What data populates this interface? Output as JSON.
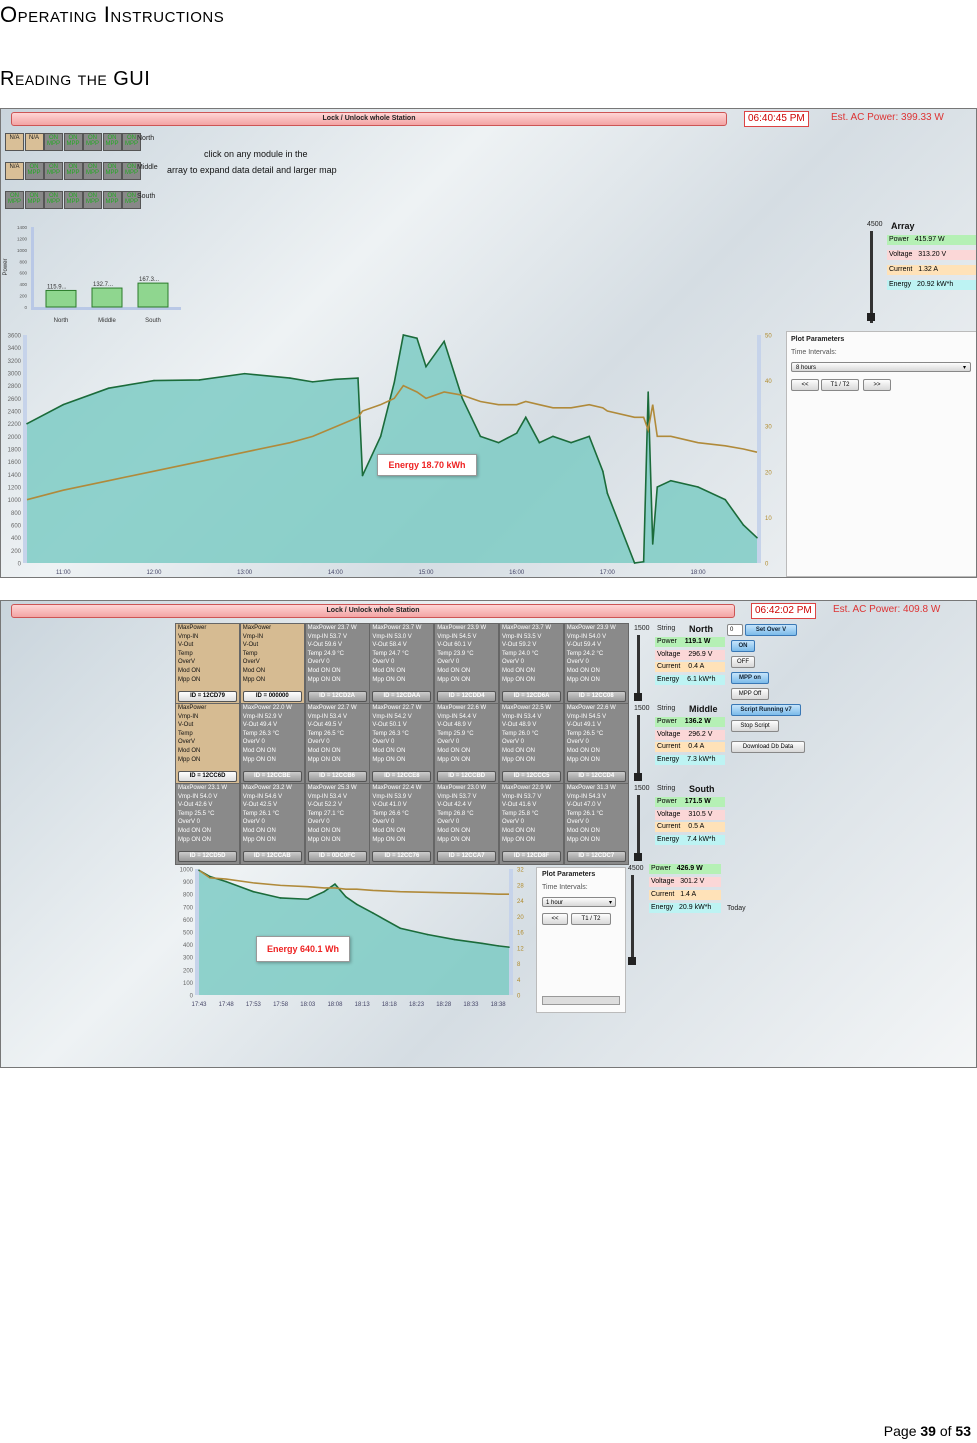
{
  "heading": {
    "title": "Operating Instructions",
    "subtitle": "Reading the GUI"
  },
  "footer": {
    "prefix": "Page",
    "page": "39",
    "of": "of",
    "total": "53"
  },
  "screen1": {
    "lock_label": "Lock / Unlock whole Station",
    "clock": "06:40:45 PM",
    "ac_power": "Est. AC Power: 399.33 W",
    "instruction_line1": "click on any module in the",
    "instruction_line2": "array to expand data detail and larger map",
    "rows": [
      {
        "name": "North",
        "cells": [
          [
            "N/A",
            ""
          ],
          [
            "N/A",
            ""
          ],
          [
            "ON",
            "MPP"
          ],
          [
            "ON",
            "MPP"
          ],
          [
            "ON",
            "MPP"
          ],
          [
            "ON",
            "MPP"
          ],
          [
            "ON",
            "MPP"
          ]
        ]
      },
      {
        "name": "Middle",
        "cells": [
          [
            "N/A",
            ""
          ],
          [
            "ON",
            "MPP"
          ],
          [
            "ON",
            "MPP"
          ],
          [
            "ON",
            "MPP"
          ],
          [
            "ON",
            "MPP"
          ],
          [
            "ON",
            "MPP"
          ],
          [
            "ON",
            "MPP"
          ]
        ]
      },
      {
        "name": "South",
        "cells": [
          [
            "ON",
            "MPP"
          ],
          [
            "ON",
            "MPP"
          ],
          [
            "ON",
            "MPP"
          ],
          [
            "ON",
            "MPP"
          ],
          [
            "ON",
            "MPP"
          ],
          [
            "ON",
            "MPP"
          ],
          [
            "ON",
            "MPP"
          ]
        ]
      }
    ],
    "array_panel": {
      "scale_max": "4500",
      "title": "Array",
      "power_label": "Power",
      "power_value": "415.97 W",
      "voltage_label": "Voltage",
      "voltage_value": "313.20 V",
      "current_label": "Current",
      "current_value": "1.32 A",
      "energy_label": "Energy",
      "energy_value": "20.92 kW*h"
    },
    "plot_params": {
      "title": "Plot Parameters",
      "intervals_label": "Time Intervals:",
      "interval_value": "8 hours",
      "prev": "<<",
      "t1t2": "T1 / T2",
      "next": ">>"
    },
    "energy_tip": "Energy 18.70 kWh"
  },
  "screen2": {
    "lock_label": "Lock / Unlock whole Station",
    "clock": "06:42:02 PM",
    "ac_power": "Est. AC Power: 409.8 W",
    "strings": [
      {
        "scale": "1500",
        "label": "String",
        "name": "North",
        "power": "119.1 W",
        "voltage": "296.9 V",
        "current": "0.4 A",
        "energy": "6.1 kW*h"
      },
      {
        "scale": "1500",
        "label": "String",
        "name": "Middle",
        "power": "136.2 W",
        "voltage": "296.2 V",
        "current": "0.4 A",
        "energy": "7.3 kW*h"
      },
      {
        "scale": "1500",
        "label": "String",
        "name": "South",
        "power": "171.5 W",
        "voltage": "310.5 V",
        "current": "0.5 A",
        "energy": "7.4 kW*h"
      }
    ],
    "kv_labels": {
      "power": "Power",
      "voltage": "Voltage",
      "current": "Current",
      "energy": "Energy"
    },
    "total": {
      "scale": "4500",
      "power": "426.9 W",
      "voltage": "301.2 V",
      "current": "1.4 A",
      "energy": "20.9 kW*h",
      "today": "Today"
    },
    "controls": {
      "input_value": "0",
      "set_over_v": "Set Over V",
      "on": "ON",
      "off": "OFF",
      "mpp_on": "MPP on",
      "mpp_off": "MPP Off",
      "script_running": "Script Running v7",
      "stop_script": "Stop Script",
      "download": "Download Db Data"
    },
    "plot_params": {
      "title": "Plot Parameters",
      "intervals_label": "Time Intervals:",
      "interval_value": "1 hour",
      "prev": "<<",
      "t1t2": "T1 / T2"
    },
    "energy_tip": "Energy 640.1 Wh",
    "module_rows": [
      [
        {
          "tan": true,
          "lines": [
            "MaxPower",
            "Vmp-IN",
            "V-Out",
            "Temp",
            "OverV",
            "Mod ON",
            "Mpp ON"
          ],
          "id": "ID = 12CD79"
        },
        {
          "tan": true,
          "lines": [
            "MaxPower",
            "Vmp-IN",
            "V-Out",
            "Temp",
            "OverV",
            "Mod ON",
            "Mpp ON"
          ],
          "id": "ID = 000000"
        },
        {
          "tan": false,
          "lines": [
            "MaxPower 23.7 W",
            "Vmp-IN 53.7 V",
            "V-Out 59.6 V",
            "Temp 24.9 °C",
            "OverV 0",
            "Mod ON ON",
            "Mpp ON ON"
          ],
          "id": "ID = 12CD2A"
        },
        {
          "tan": false,
          "lines": [
            "MaxPower 23.7 W",
            "Vmp-IN 53.0 V",
            "V-Out 58.4 V",
            "Temp 24.7 °C",
            "OverV 0",
            "Mod ON ON",
            "Mpp ON ON"
          ],
          "id": "ID = 12CDAA"
        },
        {
          "tan": false,
          "lines": [
            "MaxPower 23.9 W",
            "Vmp-IN 54.5 V",
            "V-Out 60.1 V",
            "Temp 23.9 °C",
            "OverV 0",
            "Mod ON ON",
            "Mpp ON ON"
          ],
          "id": "ID = 12CDD4"
        },
        {
          "tan": false,
          "lines": [
            "MaxPower 23.7 W",
            "Vmp-IN 53.5 V",
            "V-Out 59.2 V",
            "Temp 24.0 °C",
            "OverV 0",
            "Mod ON ON",
            "Mpp ON ON"
          ],
          "id": "ID = 12CD6A"
        },
        {
          "tan": false,
          "lines": [
            "MaxPower 23.9 W",
            "Vmp-IN 54.0 V",
            "V-Out 59.4 V",
            "Temp 24.2 °C",
            "OverV 0",
            "Mod ON ON",
            "Mpp ON ON"
          ],
          "id": "ID = 12CC08"
        }
      ],
      [
        {
          "tan": true,
          "lines": [
            "MaxPower",
            "Vmp-IN",
            "V-Out",
            "Temp",
            "OverV",
            "Mod ON",
            "Mpp ON"
          ],
          "id": "ID = 12CC6D"
        },
        {
          "tan": false,
          "lines": [
            "MaxPower 22.0 W",
            "Vmp-IN 52.9 V",
            "V-Out 49.4 V",
            "Temp 26.3 °C",
            "OverV 0",
            "Mod ON ON",
            "Mpp ON ON"
          ],
          "id": "ID = 12CCBE"
        },
        {
          "tan": false,
          "lines": [
            "MaxPower 22.7 W",
            "Vmp-IN 53.4 V",
            "V-Out 49.5 V",
            "Temp 26.5 °C",
            "OverV 0",
            "Mod ON ON",
            "Mpp ON ON"
          ],
          "id": "ID = 12CCB6"
        },
        {
          "tan": false,
          "lines": [
            "MaxPower 22.7 W",
            "Vmp-IN 54.2 V",
            "V-Out 50.1 V",
            "Temp 26.3 °C",
            "OverV 0",
            "Mod ON ON",
            "Mpp ON ON"
          ],
          "id": "ID = 12CCE8"
        },
        {
          "tan": false,
          "lines": [
            "MaxPower 22.6 W",
            "Vmp-IN 54.4 V",
            "V-Out 48.9 V",
            "Temp 25.9 °C",
            "OverV 0",
            "Mod ON ON",
            "Mpp ON ON"
          ],
          "id": "ID = 12CCBD"
        },
        {
          "tan": false,
          "lines": [
            "MaxPower 22.5 W",
            "Vmp-IN 53.4 V",
            "V-Out 48.9 V",
            "Temp 26.0 °C",
            "OverV 0",
            "Mod ON ON",
            "Mpp ON ON"
          ],
          "id": "ID = 12CCC5"
        },
        {
          "tan": false,
          "lines": [
            "MaxPower 22.6 W",
            "Vmp-IN 54.5 V",
            "V-Out 49.1 V",
            "Temp 26.5 °C",
            "OverV 0",
            "Mod ON ON",
            "Mpp ON ON"
          ],
          "id": "ID = 12CCD4"
        }
      ],
      [
        {
          "tan": false,
          "lines": [
            "MaxPower 23.1 W",
            "Vmp-IN 54.0 V",
            "V-Out 42.6 V",
            "Temp 25.5 °C",
            "OverV 0",
            "Mod ON ON",
            "Mpp ON ON"
          ],
          "id": "ID = 12CD5D"
        },
        {
          "tan": false,
          "lines": [
            "MaxPower 23.2 W",
            "Vmp-IN 54.6 V",
            "V-Out 42.5 V",
            "Temp 26.1 °C",
            "OverV 0",
            "Mod ON ON",
            "Mpp ON ON"
          ],
          "id": "ID = 12CCAB"
        },
        {
          "tan": false,
          "lines": [
            "MaxPower 25.3 W",
            "Vmp-IN 53.4 V",
            "V-Out 52.2 V",
            "Temp 27.1 °C",
            "OverV 0",
            "Mod ON ON",
            "Mpp ON ON"
          ],
          "id": "ID = 0DC0FC"
        },
        {
          "tan": false,
          "lines": [
            "MaxPower 22.4 W",
            "Vmp-IN 53.9 V",
            "V-Out 41.0 V",
            "Temp 26.6 °C",
            "OverV 0",
            "Mod ON ON",
            "Mpp ON ON"
          ],
          "id": "ID = 12CC76"
        },
        {
          "tan": false,
          "lines": [
            "MaxPower 23.0 W",
            "Vmp-IN 53.7 V",
            "V-Out 42.4 V",
            "Temp 26.8 °C",
            "OverV 0",
            "Mod ON ON",
            "Mpp ON ON"
          ],
          "id": "ID = 12CCA7"
        },
        {
          "tan": false,
          "lines": [
            "MaxPower 22.9 W",
            "Vmp-IN 53.7 V",
            "V-Out 41.6 V",
            "Temp 25.8 °C",
            "OverV 0",
            "Mod ON ON",
            "Mpp ON ON"
          ],
          "id": "ID = 12CD8F"
        },
        {
          "tan": false,
          "lines": [
            "MaxPower 31.3 W",
            "Vmp-IN 54.3 V",
            "V-Out 47.0 V",
            "Temp 26.1 °C",
            "OverV 0",
            "Mod ON ON",
            "Mpp ON ON"
          ],
          "id": "ID = 12CDC7"
        }
      ]
    ]
  },
  "chart_data": [
    {
      "type": "bar",
      "categories": [
        "North",
        "Middle",
        "South"
      ],
      "values": [
        115.9,
        132.7,
        167.3
      ],
      "data_labels": [
        "115.9...",
        "132.7...",
        "167.3..."
      ],
      "ylabel": "Power",
      "y_ticks": [
        "1400",
        "1200",
        "1000",
        "800",
        "600",
        "400",
        "200",
        "0"
      ],
      "ylim": [
        0,
        1400
      ]
    },
    {
      "type": "area",
      "x_ticks": [
        "11:00",
        "12:00",
        "13:00",
        "14:00",
        "15:00",
        "16:00",
        "17:00",
        "18:00"
      ],
      "y_ticks": [
        "3600",
        "3400",
        "3200",
        "3000",
        "2800",
        "2600",
        "2400",
        "2200",
        "2000",
        "1800",
        "1600",
        "1400",
        "1200",
        "1000",
        "800",
        "600",
        "400",
        "200",
        "0"
      ],
      "y2_ticks": [
        "50",
        "40",
        "30",
        "20",
        "10",
        "0"
      ],
      "ylim": [
        0,
        3600
      ],
      "y2lim": [
        0,
        50
      ],
      "x_hours": [
        10.6,
        11.0,
        11.5,
        12.0,
        12.5,
        13.0,
        13.5,
        13.75,
        14.0,
        14.25,
        14.3,
        14.5,
        14.65,
        14.75,
        14.9,
        15.0,
        15.2,
        15.4,
        15.5,
        15.6,
        15.8,
        16.0,
        16.1,
        16.25,
        16.4,
        16.6,
        16.8,
        16.95,
        17.0,
        17.3,
        17.4,
        17.45,
        17.5,
        17.55,
        17.7,
        18.0,
        18.3,
        18.5,
        18.65
      ],
      "series": [
        {
          "values": [
            2200,
            2500,
            2760,
            2880,
            2890,
            2990,
            2920,
            2860,
            2900,
            2920,
            1380,
            2000,
            2850,
            3600,
            3550,
            3100,
            3500,
            2600,
            2300,
            2000,
            1900,
            2050,
            2300,
            1900,
            2000,
            1900,
            2000,
            1450,
            1100,
            0,
            20,
            2700,
            300,
            1200,
            1300,
            1200,
            1000,
            600,
            400
          ]
        },
        {
          "values": [
            1000,
            1150,
            1300,
            1450,
            1600,
            1750,
            1900,
            2000,
            2150,
            2300,
            2400,
            2500,
            2600,
            2800,
            2700,
            2600,
            2700,
            2650,
            2600,
            2550,
            2500,
            2500,
            2550,
            2500,
            2450,
            2450,
            2500,
            2450,
            2400,
            2300,
            2300,
            2100,
            2500,
            2000,
            2000,
            1900,
            1850,
            1800,
            1750
          ]
        }
      ]
    },
    {
      "type": "area",
      "x_ticks": [
        "17:43",
        "17:48",
        "17:53",
        "17:58",
        "18:03",
        "18:08",
        "18:13",
        "18:18",
        "18:23",
        "18:28",
        "18:33",
        "18:38"
      ],
      "y_ticks": [
        "1000",
        "900",
        "800",
        "700",
        "600",
        "500",
        "400",
        "300",
        "200",
        "100",
        "0"
      ],
      "y2_ticks": [
        "32",
        "28",
        "24",
        "20",
        "16",
        "12",
        "8",
        "4",
        "0"
      ],
      "ylim": [
        0,
        1000
      ],
      "y2lim": [
        0,
        32
      ],
      "x_minutes": [
        43,
        45,
        48,
        53,
        58,
        63,
        66,
        68,
        70,
        72,
        75,
        80,
        85,
        90,
        95,
        98,
        100
      ],
      "series": [
        {
          "values": [
            990,
            940,
            900,
            820,
            770,
            760,
            820,
            880,
            780,
            720,
            650,
            530,
            480,
            440,
            410,
            390,
            380
          ]
        },
        {
          "values": [
            990,
            930,
            920,
            890,
            870,
            860,
            850,
            850,
            840,
            840,
            830,
            820,
            815,
            810,
            805,
            800,
            800
          ]
        }
      ]
    }
  ]
}
